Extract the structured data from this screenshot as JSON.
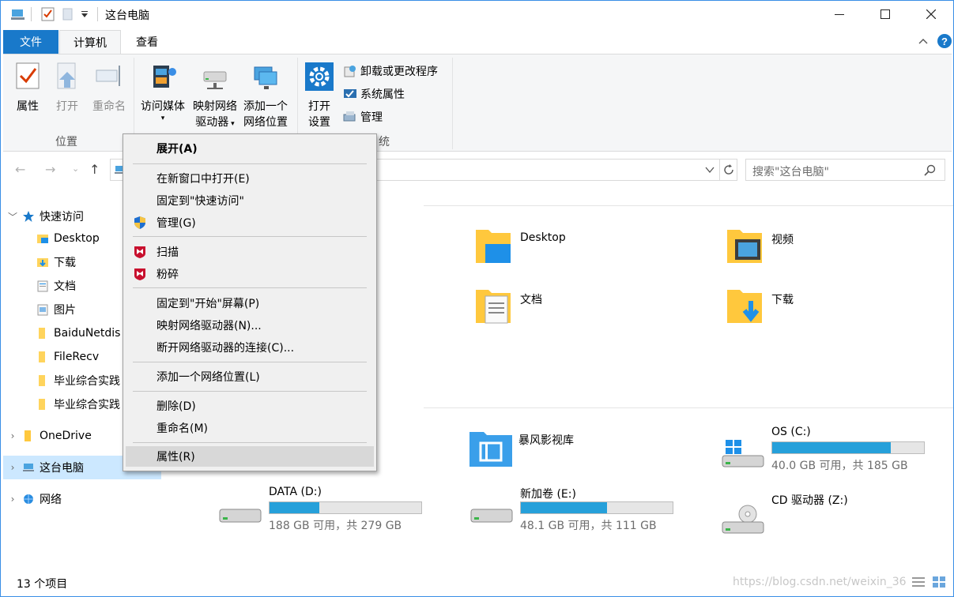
{
  "window": {
    "title": "这台电脑"
  },
  "tabs": {
    "file": "文件",
    "computer": "计算机",
    "view": "查看"
  },
  "ribbon": {
    "properties": "属性",
    "open": "打开",
    "rename": "重命名",
    "location_group": "位置",
    "access_media": "访问媒体",
    "map_drive_1": "映射网络",
    "map_drive_2": "驱动器",
    "add_location_1": "添加一个",
    "add_location_2": "网络位置",
    "open_settings_1": "打开",
    "open_settings_2": "设置",
    "uninstall": "卸载或更改程序",
    "system_properties": "系统属性",
    "manage": "管理",
    "system_group_fragment": "统"
  },
  "search": {
    "placeholder": "搜索\"这台电脑\""
  },
  "nav": {
    "quick_access": "快速访问",
    "items": [
      "Desktop",
      "下载",
      "文档",
      "图片",
      "BaiduNetdis",
      "FileRecv",
      "毕业综合实践",
      "毕业综合实践"
    ],
    "onedrive": "OneDrive",
    "this_pc": "这台电脑",
    "network": "网络"
  },
  "folders": [
    {
      "name": "Desktop"
    },
    {
      "name": "视频"
    },
    {
      "name": "文档"
    },
    {
      "name": "下载"
    }
  ],
  "drives": [
    {
      "name": "暴风影视库"
    },
    {
      "name": "OS (C:)",
      "free": "40.0 GB 可用，共 185 GB",
      "used_fraction": 0.78
    },
    {
      "name": "DATA (D:)",
      "free": "188 GB 可用，共 279 GB",
      "used_fraction": 0.33
    },
    {
      "name": "新加卷 (E:)",
      "free": "48.1 GB 可用，共 111 GB",
      "used_fraction": 0.57
    },
    {
      "name": "CD 驱动器 (Z:)"
    }
  ],
  "context_menu": {
    "expand": "展开(A)",
    "open_new_window": "在新窗口中打开(E)",
    "pin_quick": "固定到\"快速访问\"",
    "manage": "管理(G)",
    "scan": "扫描",
    "shred": "粉碎",
    "pin_start": "固定到\"开始\"屏幕(P)",
    "map_drive": "映射网络驱动器(N)...",
    "disconnect": "断开网络驱动器的连接(C)...",
    "add_location": "添加一个网络位置(L)",
    "delete": "删除(D)",
    "rename": "重命名(M)",
    "properties": "属性(R)"
  },
  "status": {
    "count": "13 个项目"
  },
  "watermark": "https://blog.csdn.net/weixin_36"
}
